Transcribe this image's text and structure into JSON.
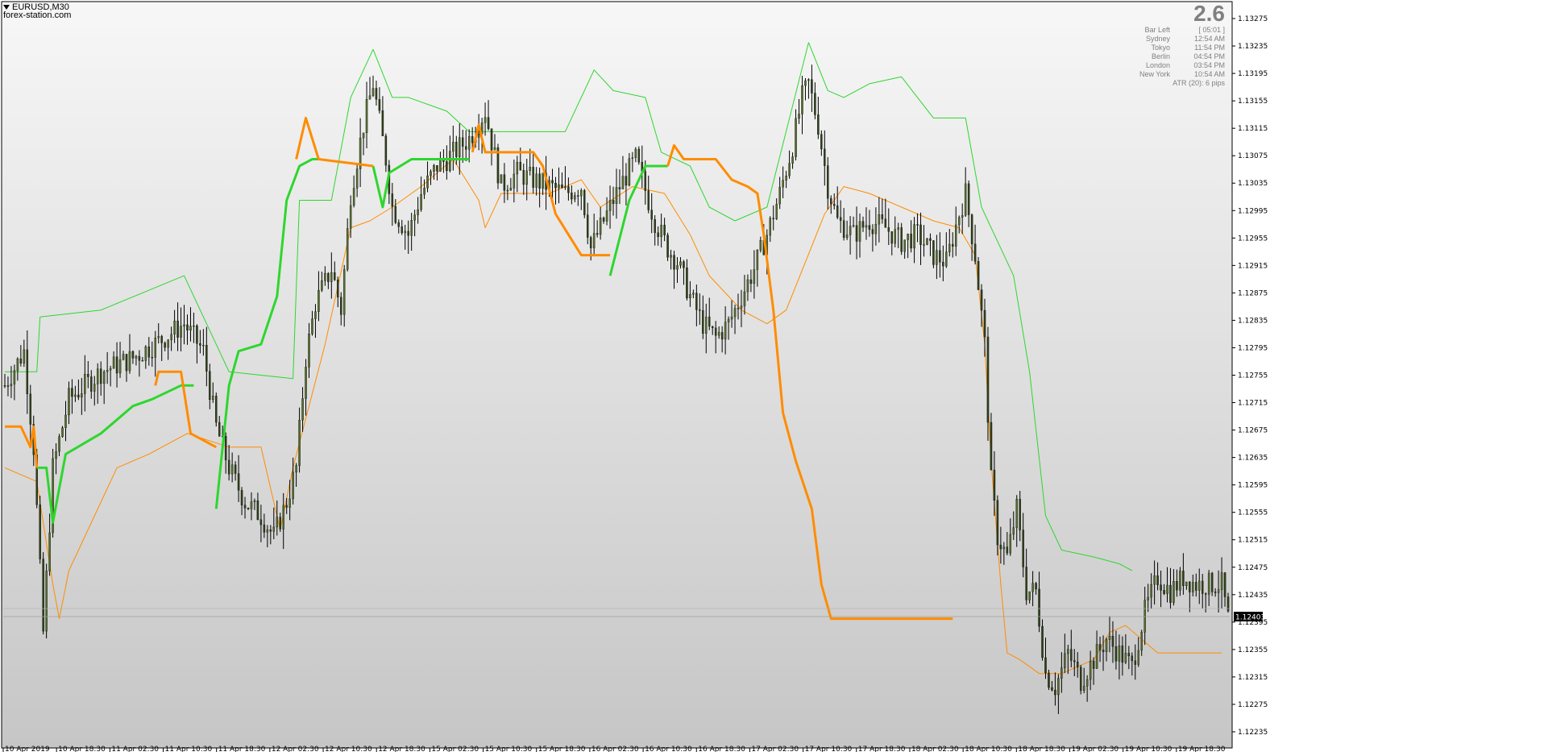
{
  "symbol": "EURUSD,M30",
  "watermark": "forex-station.com",
  "panel": {
    "value": "2.6",
    "bar_left_label": "Bar Left",
    "bar_left_value": "[ 05:01 ]",
    "clocks": [
      {
        "city": "Sydney",
        "time": "12:54 AM"
      },
      {
        "city": "Tokyo",
        "time": "11:54 PM"
      },
      {
        "city": "Berlin",
        "time": "04:54 PM"
      },
      {
        "city": "London",
        "time": "03:54 PM"
      },
      {
        "city": "New York",
        "time": "10:54 AM"
      }
    ],
    "atr": "ATR (20): 6 pips"
  },
  "current_price": "1.12403",
  "colors": {
    "bull_line": "#2ed62e",
    "bear_line": "#ff8c00",
    "candle_body": "#556b2f",
    "wick": "#000000",
    "price_tag_bg": "#000000"
  },
  "chart_data": {
    "type": "candlestick",
    "ylim": [
      1.12215,
      1.13295
    ],
    "y_ticks": [
      "1.13275",
      "1.13235",
      "1.13195",
      "1.13155",
      "1.13115",
      "1.13075",
      "1.13035",
      "1.12995",
      "1.12955",
      "1.12915",
      "1.12875",
      "1.12835",
      "1.12795",
      "1.12755",
      "1.12715",
      "1.12675",
      "1.12635",
      "1.12595",
      "1.12555",
      "1.12515",
      "1.12475",
      "1.12435",
      "1.12395",
      "1.12355",
      "1.12315",
      "1.12275",
      "1.12235"
    ],
    "x_ticks": [
      "10 Apr 2019",
      "10 Apr 18:30",
      "11 Apr 02:30",
      "11 Apr 10:30",
      "11 Apr 18:30",
      "12 Apr 02:30",
      "12 Apr 10:30",
      "12 Apr 18:30",
      "15 Apr 02:30",
      "15 Apr 10:30",
      "15 Apr 18:30",
      "16 Apr 02:30",
      "16 Apr 10:30",
      "16 Apr 18:30",
      "17 Apr 02:30",
      "17 Apr 10:30",
      "17 Apr 18:30",
      "18 Apr 02:30",
      "18 Apr 10:30",
      "18 Apr 18:30",
      "19 Apr 02:30",
      "19 Apr 10:30",
      "19 Apr 18:30"
    ],
    "close_anchors": [
      [
        0,
        1.1274
      ],
      [
        6,
        1.1279
      ],
      [
        9,
        1.1265
      ],
      [
        12,
        1.1238
      ],
      [
        15,
        1.1262
      ],
      [
        20,
        1.1272
      ],
      [
        30,
        1.1276
      ],
      [
        40,
        1.1278
      ],
      [
        50,
        1.1281
      ],
      [
        56,
        1.1283
      ],
      [
        62,
        1.1279
      ],
      [
        66,
        1.1268
      ],
      [
        70,
        1.1262
      ],
      [
        75,
        1.1257
      ],
      [
        80,
        1.1255
      ],
      [
        84,
        1.1252
      ],
      [
        88,
        1.1257
      ],
      [
        91,
        1.1262
      ],
      [
        94,
        1.1278
      ],
      [
        97,
        1.1286
      ],
      [
        102,
        1.1291
      ],
      [
        105,
        1.1285
      ],
      [
        108,
        1.1302
      ],
      [
        112,
        1.1312
      ],
      [
        115,
        1.1318
      ],
      [
        119,
        1.1307
      ],
      [
        121,
        1.13
      ],
      [
        126,
        1.1296
      ],
      [
        130,
        1.1302
      ],
      [
        135,
        1.1306
      ],
      [
        138,
        1.1307
      ],
      [
        145,
        1.131
      ],
      [
        150,
        1.1314
      ],
      [
        155,
        1.1303
      ],
      [
        160,
        1.1305
      ],
      [
        165,
        1.1304
      ],
      [
        170,
        1.1303
      ],
      [
        175,
        1.1302
      ],
      [
        180,
        1.1303
      ],
      [
        183,
        1.1294
      ],
      [
        187,
        1.1298
      ],
      [
        192,
        1.1303
      ],
      [
        197,
        1.1307
      ],
      [
        203,
        1.1298
      ],
      [
        207,
        1.1294
      ],
      [
        210,
        1.1292
      ],
      [
        214,
        1.1287
      ],
      [
        218,
        1.1283
      ],
      [
        222,
        1.1281
      ],
      [
        226,
        1.1283
      ],
      [
        230,
        1.1287
      ],
      [
        234,
        1.1291
      ],
      [
        238,
        1.1296
      ],
      [
        242,
        1.1302
      ],
      [
        246,
        1.1309
      ],
      [
        249,
        1.1316
      ],
      [
        251,
        1.1318
      ],
      [
        254,
        1.1312
      ],
      [
        257,
        1.1303
      ],
      [
        260,
        1.1298
      ],
      [
        265,
        1.1296
      ],
      [
        270,
        1.1298
      ],
      [
        275,
        1.1297
      ],
      [
        280,
        1.1295
      ],
      [
        285,
        1.1296
      ],
      [
        290,
        1.1293
      ],
      [
        294,
        1.1292
      ],
      [
        298,
        1.1299
      ],
      [
        300,
        1.1302
      ],
      [
        303,
        1.1293
      ],
      [
        306,
        1.128
      ],
      [
        308,
        1.126
      ],
      [
        310,
        1.1252
      ],
      [
        313,
        1.1249
      ],
      [
        316,
        1.1256
      ],
      [
        319,
        1.1244
      ],
      [
        322,
        1.1244
      ],
      [
        325,
        1.1232
      ],
      [
        328,
        1.123
      ],
      [
        332,
        1.1235
      ],
      [
        336,
        1.1231
      ],
      [
        340,
        1.1234
      ],
      [
        344,
        1.1237
      ],
      [
        348,
        1.1235
      ],
      [
        352,
        1.1233
      ],
      [
        356,
        1.1241
      ],
      [
        360,
        1.1246
      ],
      [
        364,
        1.1244
      ],
      [
        368,
        1.1246
      ],
      [
        372,
        1.1245
      ],
      [
        376,
        1.1245
      ],
      [
        380,
        1.1245
      ],
      [
        382,
        1.124
      ]
    ],
    "series": [
      {
        "name": "upper_band",
        "style": "thin",
        "color": "#2ed62e",
        "points": [
          [
            0,
            1.1276
          ],
          [
            10,
            1.1276
          ],
          [
            11,
            1.1284
          ],
          [
            30,
            1.1285
          ],
          [
            56,
            1.129
          ],
          [
            70,
            1.1276
          ],
          [
            90,
            1.1275
          ],
          [
            92,
            1.1301
          ],
          [
            102,
            1.1301
          ],
          [
            108,
            1.1316
          ],
          [
            115,
            1.1323
          ],
          [
            121,
            1.1316
          ],
          [
            126,
            1.1316
          ],
          [
            138,
            1.1314
          ],
          [
            145,
            1.1311
          ],
          [
            175,
            1.1311
          ],
          [
            184,
            1.132
          ],
          [
            190,
            1.1317
          ],
          [
            200,
            1.1316
          ],
          [
            205,
            1.1308
          ],
          [
            214,
            1.1306
          ],
          [
            220,
            1.13
          ],
          [
            228,
            1.1298
          ],
          [
            238,
            1.13
          ],
          [
            251,
            1.1324
          ],
          [
            257,
            1.1317
          ],
          [
            262,
            1.1316
          ],
          [
            270,
            1.1318
          ],
          [
            280,
            1.1319
          ],
          [
            285,
            1.1316
          ],
          [
            290,
            1.1313
          ],
          [
            300,
            1.1313
          ],
          [
            305,
            1.13
          ],
          [
            315,
            1.129
          ],
          [
            320,
            1.1276
          ],
          [
            325,
            1.1255
          ],
          [
            330,
            1.125
          ],
          [
            340,
            1.1249
          ],
          [
            348,
            1.1248
          ],
          [
            352,
            1.1247
          ]
        ]
      },
      {
        "name": "lower_band",
        "style": "thin",
        "color": "#ff8c00",
        "points": [
          [
            0,
            1.1262
          ],
          [
            5,
            1.1261
          ],
          [
            10,
            1.126
          ],
          [
            15,
            1.1245
          ],
          [
            17,
            1.124
          ],
          [
            20,
            1.1247
          ],
          [
            35,
            1.1262
          ],
          [
            45,
            1.1264
          ],
          [
            57,
            1.1267
          ],
          [
            70,
            1.1265
          ],
          [
            80,
            1.1265
          ],
          [
            86,
            1.1253
          ],
          [
            90,
            1.1262
          ],
          [
            100,
            1.128
          ],
          [
            108,
            1.1297
          ],
          [
            114,
            1.1298
          ],
          [
            121,
            1.13
          ],
          [
            130,
            1.1303
          ],
          [
            140,
            1.1307
          ],
          [
            148,
            1.1301
          ],
          [
            150,
            1.1297
          ],
          [
            155,
            1.1302
          ],
          [
            170,
            1.1302
          ],
          [
            180,
            1.1304
          ],
          [
            186,
            1.13
          ],
          [
            196,
            1.1303
          ],
          [
            206,
            1.1302
          ],
          [
            214,
            1.1296
          ],
          [
            220,
            1.129
          ],
          [
            230,
            1.1285
          ],
          [
            238,
            1.1283
          ],
          [
            244,
            1.1285
          ],
          [
            250,
            1.1292
          ],
          [
            256,
            1.1299
          ],
          [
            262,
            1.1303
          ],
          [
            270,
            1.1302
          ],
          [
            280,
            1.13
          ],
          [
            290,
            1.1298
          ],
          [
            298,
            1.1297
          ],
          [
            303,
            1.1293
          ],
          [
            306,
            1.128
          ],
          [
            308,
            1.1263
          ],
          [
            311,
            1.1245
          ],
          [
            313,
            1.1235
          ],
          [
            317,
            1.1234
          ],
          [
            323,
            1.1232
          ],
          [
            330,
            1.1232
          ],
          [
            340,
            1.1234
          ],
          [
            345,
            1.1238
          ],
          [
            350,
            1.1239
          ],
          [
            360,
            1.1235
          ],
          [
            372,
            1.1235
          ],
          [
            377,
            1.1235
          ],
          [
            380,
            1.1235
          ]
        ]
      },
      {
        "name": "trend_bull_a",
        "style": "thick",
        "color": "#2ed62e",
        "points": [
          [
            10,
            1.1262
          ],
          [
            13,
            1.1262
          ],
          [
            15,
            1.1254
          ],
          [
            19,
            1.1264
          ],
          [
            30,
            1.1267
          ],
          [
            35,
            1.1269
          ],
          [
            40,
            1.1271
          ],
          [
            46,
            1.1272
          ],
          [
            55,
            1.1274
          ],
          [
            59,
            1.1274
          ]
        ]
      },
      {
        "name": "trend_bull_b",
        "style": "thick",
        "color": "#2ed62e",
        "points": [
          [
            66,
            1.1256
          ],
          [
            70,
            1.1274
          ],
          [
            73,
            1.1279
          ],
          [
            80,
            1.128
          ],
          [
            85,
            1.1287
          ],
          [
            88,
            1.1301
          ],
          [
            92,
            1.1306
          ],
          [
            96,
            1.1307
          ],
          [
            98,
            1.1307
          ]
        ]
      },
      {
        "name": "trend_bull_c",
        "style": "thick",
        "color": "#2ed62e",
        "points": [
          [
            115,
            1.1306
          ],
          [
            118,
            1.13
          ],
          [
            120,
            1.1305
          ],
          [
            127,
            1.1307
          ],
          [
            145,
            1.1307
          ]
        ]
      },
      {
        "name": "trend_bull_d",
        "style": "thick",
        "color": "#2ed62e",
        "points": [
          [
            189,
            1.129
          ],
          [
            195,
            1.1301
          ],
          [
            200,
            1.1306
          ],
          [
            207,
            1.1306
          ]
        ]
      },
      {
        "name": "trend_bear_a",
        "style": "thick",
        "color": "#ff8c00",
        "points": [
          [
            0,
            1.1268
          ],
          [
            5,
            1.1268
          ],
          [
            8,
            1.1265
          ],
          [
            9,
            1.1268
          ],
          [
            10,
            1.1262
          ]
        ]
      },
      {
        "name": "trend_bear_b",
        "style": "thick",
        "color": "#ff8c00",
        "points": [
          [
            47,
            1.1274
          ],
          [
            48,
            1.1276
          ],
          [
            55,
            1.1276
          ],
          [
            58,
            1.1267
          ],
          [
            66,
            1.1265
          ]
        ]
      },
      {
        "name": "trend_bear_c",
        "style": "thick",
        "color": "#ff8c00",
        "points": [
          [
            91,
            1.1307
          ],
          [
            94,
            1.1313
          ],
          [
            98,
            1.1307
          ],
          [
            115,
            1.1306
          ]
        ]
      },
      {
        "name": "trend_bear_d",
        "style": "thick",
        "color": "#ff8c00",
        "points": [
          [
            146,
            1.1308
          ],
          [
            148,
            1.1312
          ],
          [
            150,
            1.1308
          ],
          [
            165,
            1.1308
          ],
          [
            168,
            1.1306
          ],
          [
            172,
            1.1299
          ],
          [
            176,
            1.1296
          ],
          [
            180,
            1.1293
          ],
          [
            189,
            1.1293
          ]
        ]
      },
      {
        "name": "trend_bear_e",
        "style": "thick",
        "color": "#ff8c00",
        "points": [
          [
            207,
            1.1306
          ],
          [
            209,
            1.1309
          ],
          [
            212,
            1.1307
          ],
          [
            222,
            1.1307
          ],
          [
            227,
            1.1304
          ],
          [
            232,
            1.1303
          ],
          [
            235,
            1.1302
          ],
          [
            237,
            1.1296
          ],
          [
            240,
            1.1285
          ],
          [
            243,
            1.127
          ],
          [
            247,
            1.1263
          ],
          [
            252,
            1.1256
          ],
          [
            255,
            1.1245
          ],
          [
            258,
            1.124
          ],
          [
            262,
            1.124
          ],
          [
            270,
            1.124
          ],
          [
            296,
            1.124
          ]
        ]
      }
    ]
  }
}
